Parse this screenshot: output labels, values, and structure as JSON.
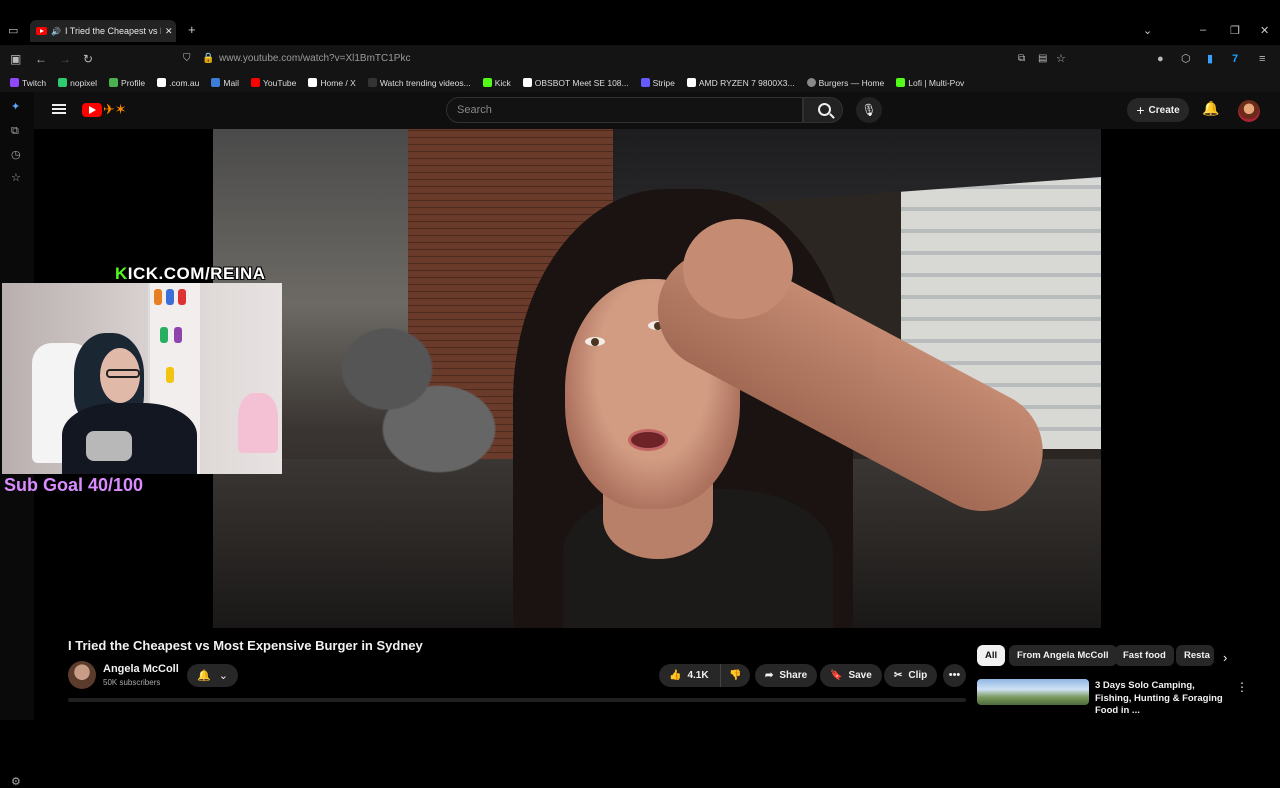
{
  "browser": {
    "tab_title": "I Tried the Cheapest vs Most Expensive Burger in Sydney",
    "tab_audio_icon": "speaker-icon",
    "new_tab": "+",
    "url": "www.youtube.com/watch?v=Xl1BmTC1Pkc",
    "bookmarks": [
      {
        "label": "Twitch",
        "color": "#9146ff"
      },
      {
        "label": "nopixel",
        "color": "#2ecc71"
      },
      {
        "label": "Profile",
        "color": "#4caf50"
      },
      {
        "label": ".com.au",
        "color": "#ffffff"
      },
      {
        "label": "Mail",
        "color": "#3b7dd8"
      },
      {
        "label": "YouTube",
        "color": "#ff0000"
      },
      {
        "label": "Home / X",
        "color": "#ffffff"
      },
      {
        "label": "Watch trending videos...",
        "color": "#111111"
      },
      {
        "label": "Kick",
        "color": "#53fc18"
      },
      {
        "label": "OBSBOT Meet SE 108...",
        "color": "#ffffff"
      },
      {
        "label": "Stripe",
        "color": "#635bff"
      },
      {
        "label": "AMD RYZEN 7 9800X3...",
        "color": "#ffffff"
      },
      {
        "label": "Burgers — Home",
        "color": "#888888"
      },
      {
        "label": "Lofi | Multi-Pov",
        "color": "#53fc18"
      }
    ]
  },
  "youtube": {
    "search_placeholder": "Search",
    "create_label": "Create",
    "video_title": "I Tried the Cheapest vs Most Expensive Burger in Sydney",
    "channel_name": "Angela McColl",
    "subscribers": "50K subscribers",
    "like_count": "4.1K",
    "share_label": "Share",
    "save_label": "Save",
    "clip_label": "Clip",
    "chips": [
      {
        "label": "All",
        "active": true
      },
      {
        "label": "From Angela McColl",
        "active": false
      },
      {
        "label": "Fast food",
        "active": false
      },
      {
        "label": "Resta",
        "active": false
      }
    ],
    "recommended": {
      "title": "3 Days Solo Camping, Fishing, Hunting & Foraging Food in ..."
    }
  },
  "overlay": {
    "kick_k": "K",
    "kick_rest": "ICK.COM/REINA",
    "sub_goal": "Sub Goal 40/100"
  },
  "colors": {
    "accent_red": "#ff0000",
    "kick_green": "#53fc18",
    "sub_goal_purple": "#d98cff"
  }
}
